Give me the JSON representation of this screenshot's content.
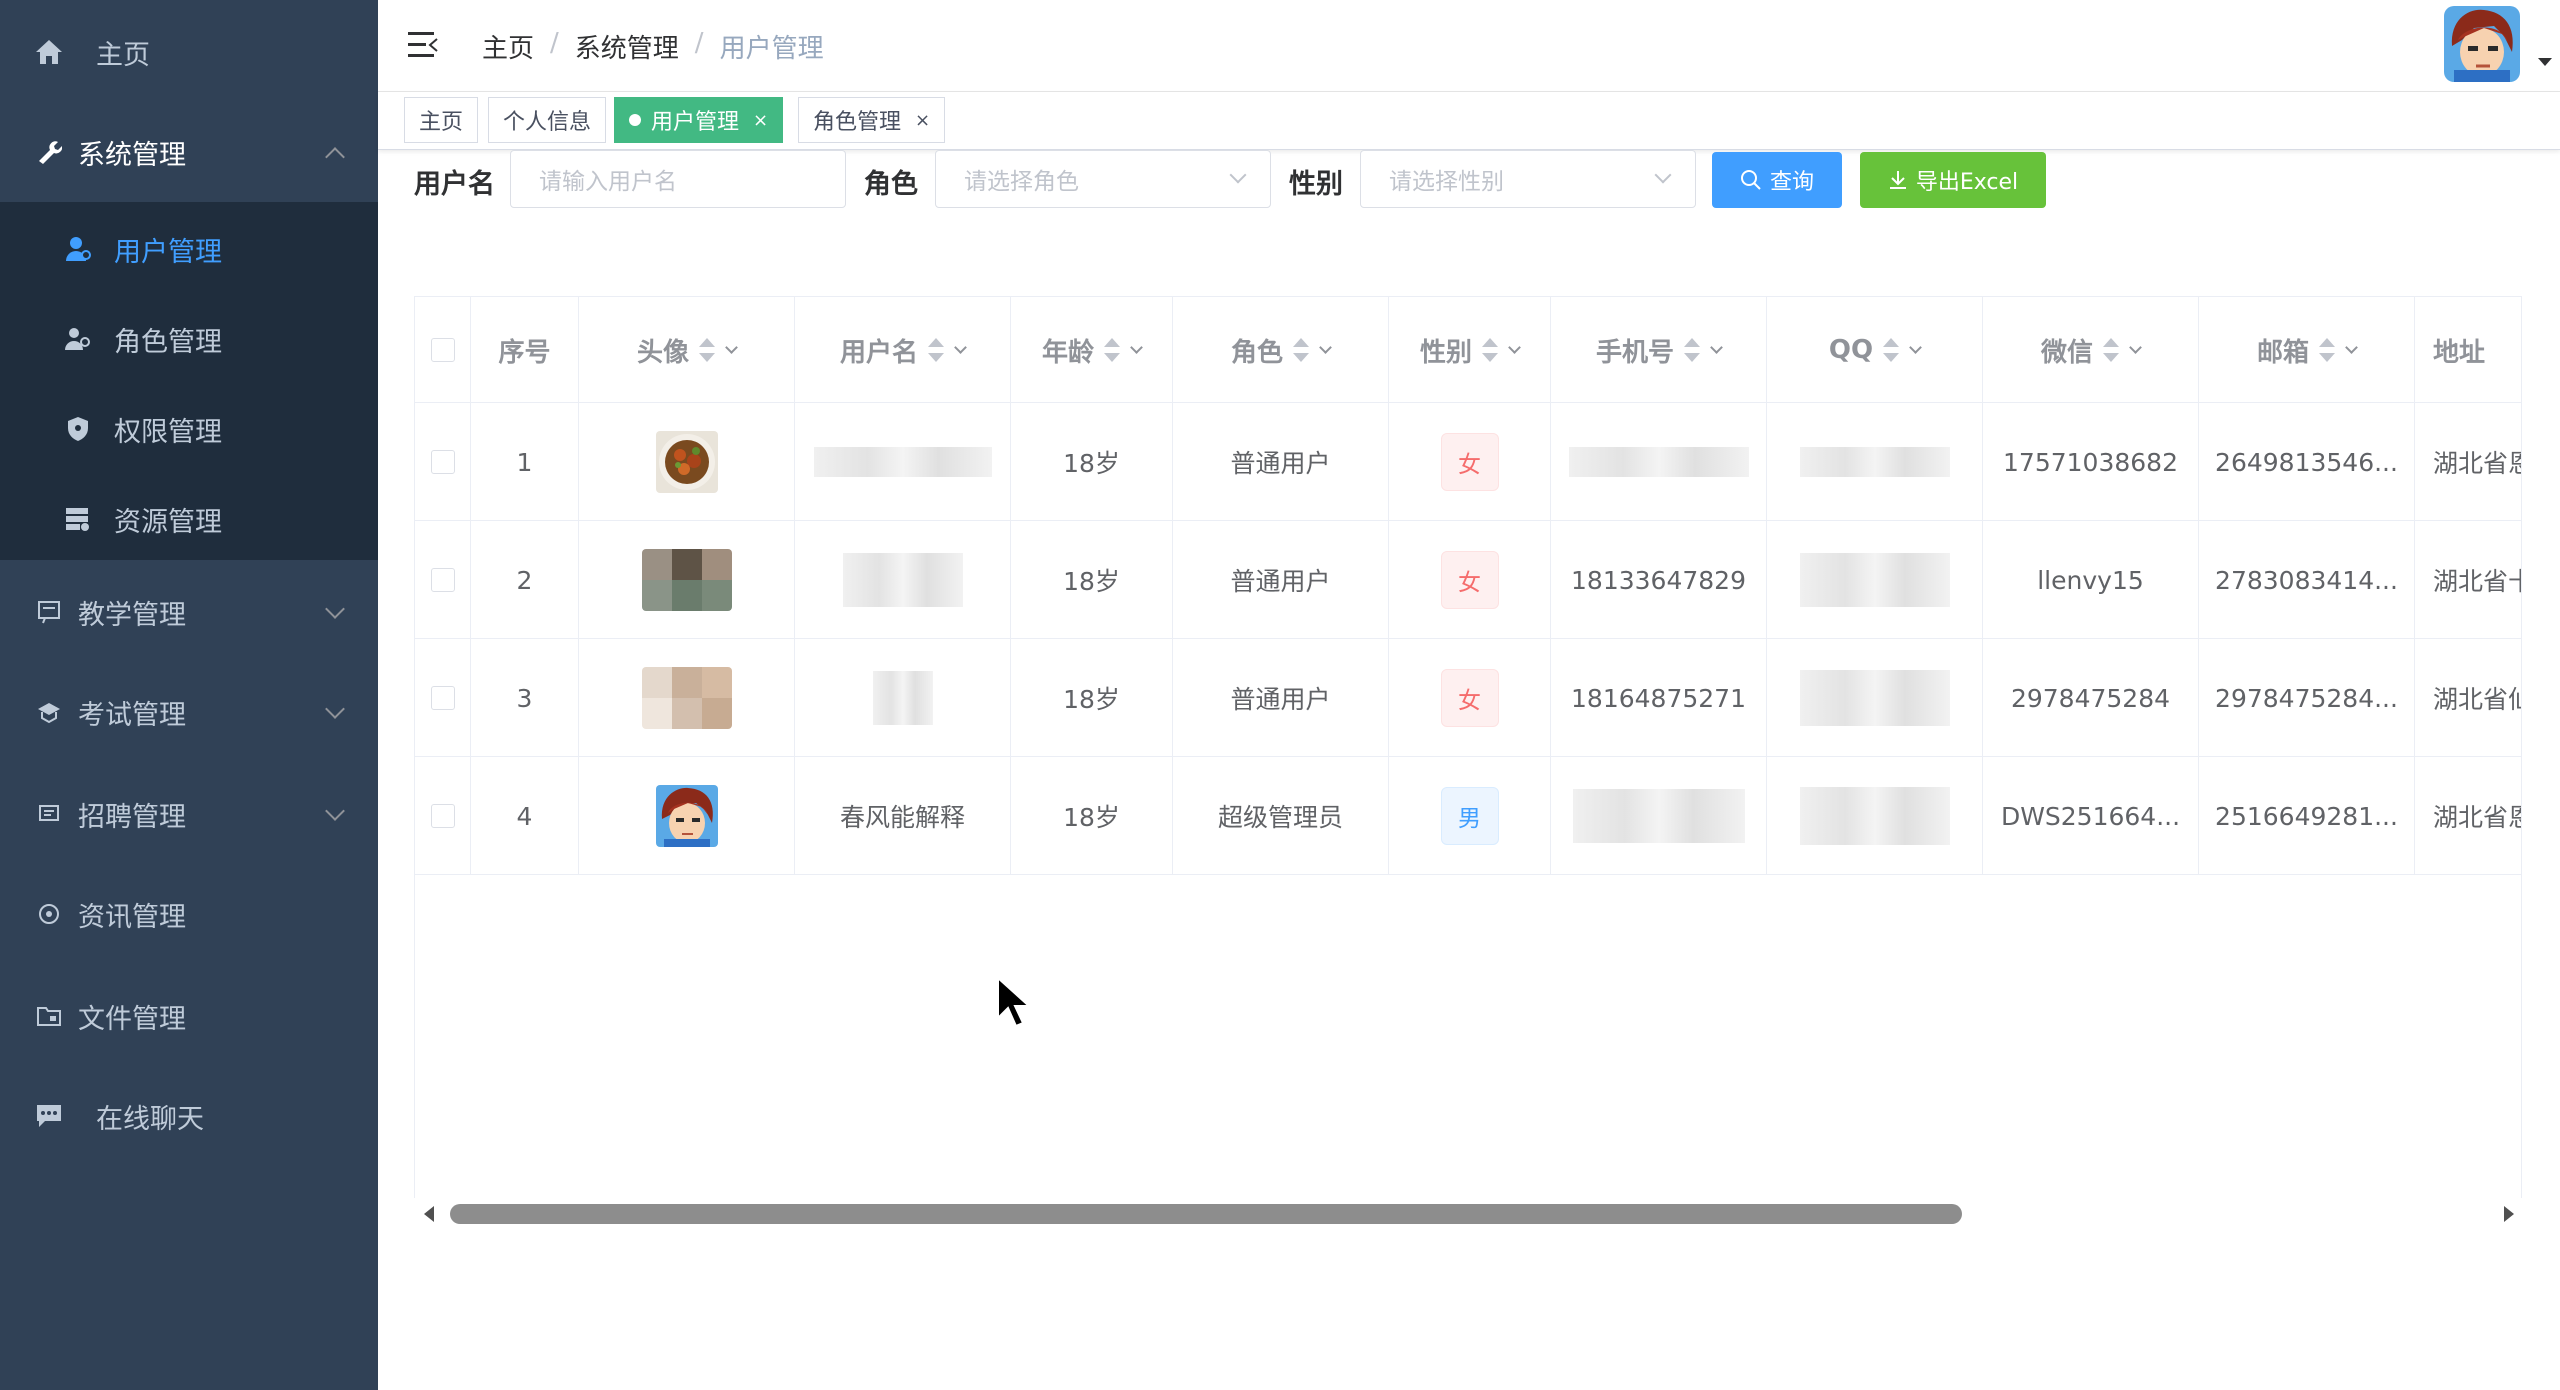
{
  "sidebar": {
    "items": [
      {
        "label": "主页",
        "icon": "home-icon"
      },
      {
        "label": "系统管理",
        "icon": "wrench-icon"
      },
      {
        "label": "教学管理",
        "icon": "teaching-icon"
      },
      {
        "label": "考试管理",
        "icon": "exam-icon"
      },
      {
        "label": "招聘管理",
        "icon": "recruit-icon"
      },
      {
        "label": "资讯管理",
        "icon": "news-icon"
      },
      {
        "label": "文件管理",
        "icon": "folder-icon"
      },
      {
        "label": "在线聊天",
        "icon": "chat-icon"
      }
    ],
    "sub_items": [
      {
        "label": "用户管理",
        "icon": "user-icon"
      },
      {
        "label": "角色管理",
        "icon": "role-icon"
      },
      {
        "label": "权限管理",
        "icon": "shield-icon"
      },
      {
        "label": "资源管理",
        "icon": "resource-icon"
      }
    ]
  },
  "header": {
    "breadcrumb": [
      "主页",
      "系统管理",
      "用户管理"
    ],
    "separator": "/"
  },
  "tags": [
    {
      "label": "主页"
    },
    {
      "label": "个人信息"
    },
    {
      "label": "用户管理",
      "close": "×"
    },
    {
      "label": "角色管理",
      "close": "×"
    }
  ],
  "filter": {
    "username_label": "用户名",
    "username_placeholder": "请输入用户名",
    "role_label": "角色",
    "role_placeholder": "请选择角色",
    "sex_label": "性别",
    "sex_placeholder": "请选择性别",
    "search_button": "查询",
    "export_button": "导出Excel"
  },
  "table": {
    "headers": [
      "序号",
      "头像",
      "用户名",
      "年龄",
      "角色",
      "性别",
      "手机号",
      "QQ",
      "微信",
      "邮箱",
      "地址"
    ],
    "rows": [
      {
        "index": "1",
        "username": "",
        "age": "18岁",
        "role": "普通用户",
        "sex": "女",
        "phone": "",
        "qq": "",
        "wechat": "17571038682",
        "email": "2649813546...",
        "address": "湖北省恩"
      },
      {
        "index": "2",
        "username": "",
        "age": "18岁",
        "role": "普通用户",
        "sex": "女",
        "phone": "18133647829",
        "qq": "",
        "wechat": "llenvy15",
        "email": "2783083414...",
        "address": "湖北省十"
      },
      {
        "index": "3",
        "username": "",
        "age": "18岁",
        "role": "普通用户",
        "sex": "女",
        "phone": "18164875271",
        "qq": "",
        "wechat": "2978475284",
        "email": "2978475284...",
        "address": "湖北省仙"
      },
      {
        "index": "4",
        "username": "春风能解释",
        "age": "18岁",
        "role": "超级管理员",
        "sex": "男",
        "phone": "",
        "qq": "",
        "wechat": "DWS251664...",
        "email": "2516649281...",
        "address": "湖北省恩"
      }
    ]
  },
  "colors": {
    "sidebar": "#304156",
    "submenu": "#1f2d3d",
    "active": "#409eff",
    "tag_active": "#42b983",
    "export": "#67c23a"
  }
}
